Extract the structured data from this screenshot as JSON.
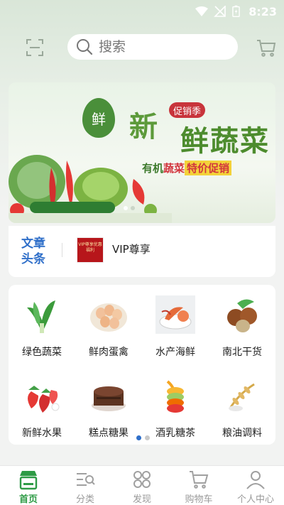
{
  "status_bar": {
    "time": "8:23"
  },
  "search": {
    "placeholder": "搜索"
  },
  "banner": {
    "logo_text": "鲜",
    "promo_tag": "促销季",
    "title_line1": "新",
    "title_line2": "鲜蔬菜",
    "subtitle_prefix": "有机",
    "subtitle_highlight": "蔬菜",
    "subtitle_tag": "特价促销"
  },
  "news": {
    "label": "文章头条",
    "thumb_text": "VIP尊享优惠福利",
    "title": "VIP尊享"
  },
  "categories": [
    {
      "label": "绿色蔬菜",
      "icon": "leafy-greens-icon"
    },
    {
      "label": "鲜肉蛋禽",
      "icon": "eggs-icon"
    },
    {
      "label": "水产海鲜",
      "icon": "seafood-icon"
    },
    {
      "label": "南北干货",
      "icon": "nuts-icon"
    },
    {
      "label": "新鲜水果",
      "icon": "strawberry-icon"
    },
    {
      "label": "糕点糖果",
      "icon": "cake-icon"
    },
    {
      "label": "酒乳糖茶",
      "icon": "juice-icon"
    },
    {
      "label": "粮油调料",
      "icon": "grain-icon"
    }
  ],
  "tabbar": {
    "items": [
      {
        "label": "首页",
        "icon": "home-store-icon",
        "active": true
      },
      {
        "label": "分类",
        "icon": "category-list-icon",
        "active": false
      },
      {
        "label": "发现",
        "icon": "discover-icon",
        "active": false
      },
      {
        "label": "购物车",
        "icon": "cart-icon",
        "active": false
      },
      {
        "label": "个人中心",
        "icon": "user-icon",
        "active": false
      }
    ]
  },
  "colors": {
    "accent_green": "#2e9b46",
    "link_blue": "#2f6fc9",
    "promo_red": "#c8343b"
  }
}
